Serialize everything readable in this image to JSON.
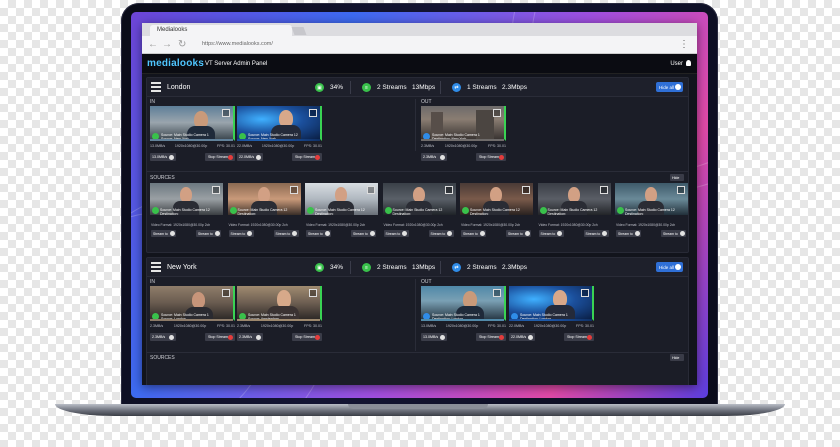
{
  "browser": {
    "tab_title": "Medialooks",
    "url": "https://www.medialooks.com/"
  },
  "app": {
    "logo": "medialooks",
    "title": "VT Server Admin Panel",
    "user": "User"
  },
  "icons": {
    "back": "arrow-left-icon",
    "forward": "arrow-right-icon",
    "reload": "reload-icon",
    "menu": "kebab-menu-icon",
    "user": "user-icon",
    "expand": "expand-icon",
    "hamburger": "hamburger-icon"
  },
  "colors": {
    "live_border": "#39d353",
    "accent": "#2f6fd6",
    "stop": "#e43c3c"
  },
  "sections": [
    {
      "city": "London",
      "cpu": "34%",
      "out_streams": "2 Streams",
      "out_rate": "13Mbps",
      "in_streams": "1 Streams",
      "in_rate": "2.3Mbps",
      "hide_all": "Hide all",
      "in_label": "IN",
      "out_label": "OUT",
      "sources_label": "SOURCES",
      "hide": "Hide",
      "in_cards": [
        {
          "line1": "Source: Main Studio Camera 1",
          "line2": "Source: New York",
          "rate": "13.0MB/s",
          "fmt": "1920x1080@30.00p",
          "fps": "FPS: 30.01",
          "badge": "13.0MB/s",
          "stop": "Stop Stream"
        },
        {
          "line1": "Source: Main Studio Camera 12",
          "line2": "Source: New York",
          "rate": "22.0MB/s",
          "fmt": "1920x1080@30.00p",
          "fps": "FPS: 30.01",
          "badge": "22.0MB/s",
          "stop": "Stop Stream"
        }
      ],
      "out_cards": [
        {
          "line1": "Source: Main Studio Camera 1",
          "line2": "Destination: New York",
          "rate": "2.3MB/s",
          "fmt": "1920x1080@30.00p",
          "fps": "FPS: 30.01",
          "badge": "2.3MB/s",
          "stop": "Stop Stream"
        }
      ],
      "sources": [
        {
          "line1": "Source: Main Studio Camera 12",
          "line2": "Destination:",
          "fmt": "Video Format: 1920x1080@30.00p 2ch",
          "btn": "Stream to"
        },
        {
          "line1": "Source: Main Studio Camera 12",
          "line2": "Destination:",
          "fmt": "Video Format: 1920x1080@30.00p 2ch",
          "btn": "Stream to"
        },
        {
          "line1": "Source: Main Studio Camera 12",
          "line2": "Destination:",
          "fmt": "Video Format: 1920x1080@30.00p 2ch",
          "btn": "Stream to"
        },
        {
          "line1": "Source: Main Studio Camera 12",
          "line2": "Destination:",
          "fmt": "Video Format: 1920x1080@30.00p 2ch",
          "btn": "Stream to"
        },
        {
          "line1": "Source: Main Studio Camera 12",
          "line2": "Destination:",
          "fmt": "Video Format: 1920x1080@30.00p 2ch",
          "btn": "Stream to"
        },
        {
          "line1": "Source: Main Studio Camera 12",
          "line2": "Destination:",
          "fmt": "Video Format: 1920x1080@30.00p 2ch",
          "btn": "Stream to"
        },
        {
          "line1": "Source: Main Studio Camera 12",
          "line2": "Destination:",
          "fmt": "Video Format: 1920x1080@30.00p 2ch",
          "btn": "Stream to"
        }
      ]
    },
    {
      "city": "New York",
      "cpu": "34%",
      "out_streams": "2 Streams",
      "out_rate": "13Mbps",
      "in_streams": "2 Streams",
      "in_rate": "2.3Mbps",
      "hide_all": "Hide all",
      "in_label": "IN",
      "out_label": "OUT",
      "sources_label": "SOURCES",
      "hide": "Hide",
      "in_cards": [
        {
          "line1": "Source: Main Studio Camera 1",
          "line2": "Source: London",
          "rate": "2.3MB/s",
          "fmt": "1920x1080@30.00p",
          "fps": "FPS: 30.01",
          "badge": "2.3MB/s",
          "stop": "Stop Stream"
        },
        {
          "line1": "Source: Main Studio Camera 1",
          "line2": "Source: Amsterdam",
          "rate": "2.3MB/s",
          "fmt": "1920x1080@30.00p",
          "fps": "FPS: 30.01",
          "badge": "2.3MB/s",
          "stop": "Stop Stream"
        }
      ],
      "out_cards": [
        {
          "line1": "Source: Main Studio Camera 1",
          "line2": "Destination: London",
          "rate": "13.0MB/s",
          "fmt": "1920x1080@30.00p",
          "fps": "FPS: 30.01",
          "badge": "13.0MB/s",
          "stop": "Stop Stream"
        },
        {
          "line1": "Source: Main Studio Camera 1",
          "line2": "Destination: London",
          "rate": "22.0MB/s",
          "fmt": "1920x1080@30.00p",
          "fps": "FPS: 30.01",
          "badge": "22.0MB/s",
          "stop": "Stop Stream"
        }
      ]
    }
  ]
}
